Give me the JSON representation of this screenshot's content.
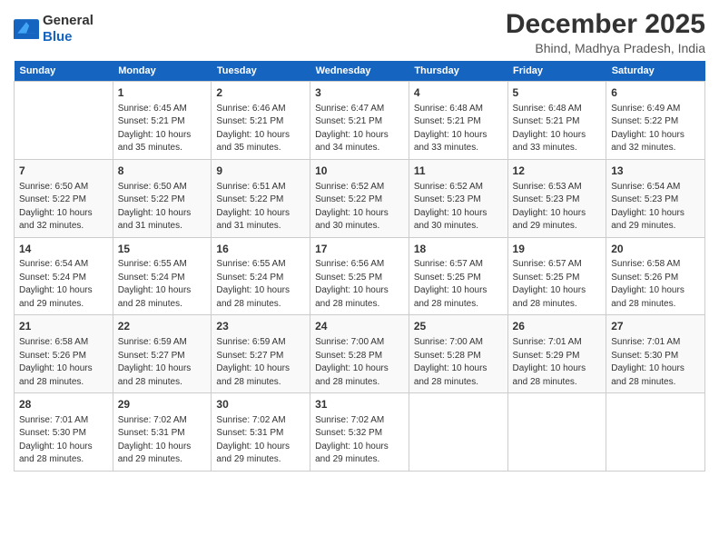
{
  "header": {
    "logo_general": "General",
    "logo_blue": "Blue",
    "title": "December 2025",
    "subtitle": "Bhind, Madhya Pradesh, India"
  },
  "days_of_week": [
    "Sunday",
    "Monday",
    "Tuesday",
    "Wednesday",
    "Thursday",
    "Friday",
    "Saturday"
  ],
  "weeks": [
    {
      "days": [
        {
          "num": "",
          "info": ""
        },
        {
          "num": "1",
          "info": "Sunrise: 6:45 AM\nSunset: 5:21 PM\nDaylight: 10 hours\nand 35 minutes."
        },
        {
          "num": "2",
          "info": "Sunrise: 6:46 AM\nSunset: 5:21 PM\nDaylight: 10 hours\nand 35 minutes."
        },
        {
          "num": "3",
          "info": "Sunrise: 6:47 AM\nSunset: 5:21 PM\nDaylight: 10 hours\nand 34 minutes."
        },
        {
          "num": "4",
          "info": "Sunrise: 6:48 AM\nSunset: 5:21 PM\nDaylight: 10 hours\nand 33 minutes."
        },
        {
          "num": "5",
          "info": "Sunrise: 6:48 AM\nSunset: 5:21 PM\nDaylight: 10 hours\nand 33 minutes."
        },
        {
          "num": "6",
          "info": "Sunrise: 6:49 AM\nSunset: 5:22 PM\nDaylight: 10 hours\nand 32 minutes."
        }
      ]
    },
    {
      "days": [
        {
          "num": "7",
          "info": "Sunrise: 6:50 AM\nSunset: 5:22 PM\nDaylight: 10 hours\nand 32 minutes."
        },
        {
          "num": "8",
          "info": "Sunrise: 6:50 AM\nSunset: 5:22 PM\nDaylight: 10 hours\nand 31 minutes."
        },
        {
          "num": "9",
          "info": "Sunrise: 6:51 AM\nSunset: 5:22 PM\nDaylight: 10 hours\nand 31 minutes."
        },
        {
          "num": "10",
          "info": "Sunrise: 6:52 AM\nSunset: 5:22 PM\nDaylight: 10 hours\nand 30 minutes."
        },
        {
          "num": "11",
          "info": "Sunrise: 6:52 AM\nSunset: 5:23 PM\nDaylight: 10 hours\nand 30 minutes."
        },
        {
          "num": "12",
          "info": "Sunrise: 6:53 AM\nSunset: 5:23 PM\nDaylight: 10 hours\nand 29 minutes."
        },
        {
          "num": "13",
          "info": "Sunrise: 6:54 AM\nSunset: 5:23 PM\nDaylight: 10 hours\nand 29 minutes."
        }
      ]
    },
    {
      "days": [
        {
          "num": "14",
          "info": "Sunrise: 6:54 AM\nSunset: 5:24 PM\nDaylight: 10 hours\nand 29 minutes."
        },
        {
          "num": "15",
          "info": "Sunrise: 6:55 AM\nSunset: 5:24 PM\nDaylight: 10 hours\nand 28 minutes."
        },
        {
          "num": "16",
          "info": "Sunrise: 6:55 AM\nSunset: 5:24 PM\nDaylight: 10 hours\nand 28 minutes."
        },
        {
          "num": "17",
          "info": "Sunrise: 6:56 AM\nSunset: 5:25 PM\nDaylight: 10 hours\nand 28 minutes."
        },
        {
          "num": "18",
          "info": "Sunrise: 6:57 AM\nSunset: 5:25 PM\nDaylight: 10 hours\nand 28 minutes."
        },
        {
          "num": "19",
          "info": "Sunrise: 6:57 AM\nSunset: 5:25 PM\nDaylight: 10 hours\nand 28 minutes."
        },
        {
          "num": "20",
          "info": "Sunrise: 6:58 AM\nSunset: 5:26 PM\nDaylight: 10 hours\nand 28 minutes."
        }
      ]
    },
    {
      "days": [
        {
          "num": "21",
          "info": "Sunrise: 6:58 AM\nSunset: 5:26 PM\nDaylight: 10 hours\nand 28 minutes."
        },
        {
          "num": "22",
          "info": "Sunrise: 6:59 AM\nSunset: 5:27 PM\nDaylight: 10 hours\nand 28 minutes."
        },
        {
          "num": "23",
          "info": "Sunrise: 6:59 AM\nSunset: 5:27 PM\nDaylight: 10 hours\nand 28 minutes."
        },
        {
          "num": "24",
          "info": "Sunrise: 7:00 AM\nSunset: 5:28 PM\nDaylight: 10 hours\nand 28 minutes."
        },
        {
          "num": "25",
          "info": "Sunrise: 7:00 AM\nSunset: 5:28 PM\nDaylight: 10 hours\nand 28 minutes."
        },
        {
          "num": "26",
          "info": "Sunrise: 7:01 AM\nSunset: 5:29 PM\nDaylight: 10 hours\nand 28 minutes."
        },
        {
          "num": "27",
          "info": "Sunrise: 7:01 AM\nSunset: 5:30 PM\nDaylight: 10 hours\nand 28 minutes."
        }
      ]
    },
    {
      "days": [
        {
          "num": "28",
          "info": "Sunrise: 7:01 AM\nSunset: 5:30 PM\nDaylight: 10 hours\nand 28 minutes."
        },
        {
          "num": "29",
          "info": "Sunrise: 7:02 AM\nSunset: 5:31 PM\nDaylight: 10 hours\nand 29 minutes."
        },
        {
          "num": "30",
          "info": "Sunrise: 7:02 AM\nSunset: 5:31 PM\nDaylight: 10 hours\nand 29 minutes."
        },
        {
          "num": "31",
          "info": "Sunrise: 7:02 AM\nSunset: 5:32 PM\nDaylight: 10 hours\nand 29 minutes."
        },
        {
          "num": "",
          "info": ""
        },
        {
          "num": "",
          "info": ""
        },
        {
          "num": "",
          "info": ""
        }
      ]
    }
  ]
}
